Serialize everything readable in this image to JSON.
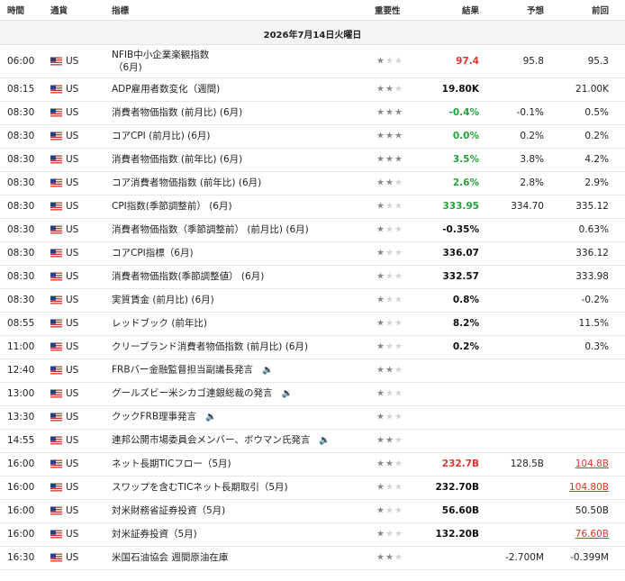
{
  "header": {
    "time": "時間",
    "currency": "通貨",
    "indicator": "指標",
    "importance": "重要性",
    "actual": "結果",
    "forecast": "予想",
    "previous": "前回"
  },
  "date_label": "2026年7月14日火曜日",
  "rows": [
    {
      "time": "06:00",
      "currency": "US",
      "name": "NFIB中小企業楽観指数",
      "name2": "（6月)",
      "stars": 1,
      "actual": "97.4",
      "actual_color": "red",
      "forecast": "95.8",
      "previous": "95.3",
      "prev_link": false,
      "speech": false
    },
    {
      "time": "08:15",
      "currency": "US",
      "name": "ADP雇用者数変化（週間)",
      "stars": 2,
      "actual": "19.80K",
      "actual_color": "black",
      "forecast": "",
      "previous": "21.00K",
      "prev_link": false,
      "speech": false
    },
    {
      "time": "08:30",
      "currency": "US",
      "name": "消費者物価指数 (前月比) (6月)",
      "stars": 3,
      "actual": "-0.4%",
      "actual_color": "green",
      "forecast": "-0.1%",
      "previous": "0.5%",
      "prev_link": false,
      "speech": false
    },
    {
      "time": "08:30",
      "currency": "US",
      "name": "コアCPI (前月比) (6月)",
      "stars": 3,
      "actual": "0.0%",
      "actual_color": "green",
      "forecast": "0.2%",
      "previous": "0.2%",
      "prev_link": false,
      "speech": false
    },
    {
      "time": "08:30",
      "currency": "US",
      "name": "消費者物価指数 (前年比) (6月)",
      "stars": 3,
      "actual": "3.5%",
      "actual_color": "green",
      "forecast": "3.8%",
      "previous": "4.2%",
      "prev_link": false,
      "speech": false
    },
    {
      "time": "08:30",
      "currency": "US",
      "name": "コア消費者物価指数 (前年比) (6月)",
      "stars": 2,
      "actual": "2.6%",
      "actual_color": "green",
      "forecast": "2.8%",
      "previous": "2.9%",
      "prev_link": false,
      "speech": false
    },
    {
      "time": "08:30",
      "currency": "US",
      "name": "CPI指数(季節調整前）  (6月)",
      "stars": 1,
      "actual": "333.95",
      "actual_color": "green",
      "forecast": "334.70",
      "previous": "335.12",
      "prev_link": false,
      "speech": false
    },
    {
      "time": "08:30",
      "currency": "US",
      "name": "消費者物価指数（季節調整前） (前月比) (6月)",
      "stars": 1,
      "actual": "-0.35%",
      "actual_color": "black",
      "forecast": "",
      "previous": "0.63%",
      "prev_link": false,
      "speech": false
    },
    {
      "time": "08:30",
      "currency": "US",
      "name": "コアCPI指標（6月)",
      "stars": 1,
      "actual": "336.07",
      "actual_color": "black",
      "forecast": "",
      "previous": "336.12",
      "prev_link": false,
      "speech": false
    },
    {
      "time": "08:30",
      "currency": "US",
      "name": "消費者物価指数(季節調整値） (6月)",
      "stars": 1,
      "actual": "332.57",
      "actual_color": "black",
      "forecast": "",
      "previous": "333.98",
      "prev_link": false,
      "speech": false
    },
    {
      "time": "08:30",
      "currency": "US",
      "name": "実質賃金 (前月比) (6月)",
      "stars": 1,
      "actual": "0.8%",
      "actual_color": "black",
      "forecast": "",
      "previous": "-0.2%",
      "prev_link": false,
      "speech": false
    },
    {
      "time": "08:55",
      "currency": "US",
      "name": "レッドブック (前年比)",
      "stars": 1,
      "actual": "8.2%",
      "actual_color": "black",
      "forecast": "",
      "previous": "11.5%",
      "prev_link": false,
      "speech": false
    },
    {
      "time": "11:00",
      "currency": "US",
      "name": "クリーブランド消費者物価指数 (前月比) (6月)",
      "stars": 1,
      "actual": "0.2%",
      "actual_color": "black",
      "forecast": "",
      "previous": "0.3%",
      "prev_link": false,
      "speech": false
    },
    {
      "time": "12:40",
      "currency": "US",
      "name": "FRBバー金融監督担当副議長発言",
      "stars": 2,
      "actual": "",
      "actual_color": "black",
      "forecast": "",
      "previous": "",
      "prev_link": false,
      "speech": true
    },
    {
      "time": "13:00",
      "currency": "US",
      "name": "グールズビー米シカゴ連銀総裁の発言",
      "stars": 1,
      "actual": "",
      "actual_color": "black",
      "forecast": "",
      "previous": "",
      "prev_link": false,
      "speech": true
    },
    {
      "time": "13:30",
      "currency": "US",
      "name": "クックFRB理事発言",
      "stars": 1,
      "actual": "",
      "actual_color": "black",
      "forecast": "",
      "previous": "",
      "prev_link": false,
      "speech": true
    },
    {
      "time": "14:55",
      "currency": "US",
      "name": "連邦公開市場委員会メンバー、ボウマン氏発言",
      "stars": 2,
      "actual": "",
      "actual_color": "black",
      "forecast": "",
      "previous": "",
      "prev_link": false,
      "speech": true
    },
    {
      "time": "16:00",
      "currency": "US",
      "name": "ネット長期TICフロー（5月)",
      "stars": 2,
      "actual": "232.7B",
      "actual_color": "red",
      "forecast": "128.5B",
      "previous": "104.8B",
      "prev_link": true,
      "speech": false
    },
    {
      "time": "16:00",
      "currency": "US",
      "name": "スワップを含むTICネット長期取引（5月)",
      "stars": 1,
      "actual": "232.70B",
      "actual_color": "black",
      "forecast": "",
      "previous": "104.80B",
      "prev_link": true,
      "speech": false
    },
    {
      "time": "16:00",
      "currency": "US",
      "name": "対米財務省証券投資（5月)",
      "stars": 1,
      "actual": "56.60B",
      "actual_color": "black",
      "forecast": "",
      "previous": "50.50B",
      "prev_link": false,
      "speech": false
    },
    {
      "time": "16:00",
      "currency": "US",
      "name": "対米証券投資（5月)",
      "stars": 1,
      "actual": "132.20B",
      "actual_color": "black",
      "forecast": "",
      "previous": "76.60B",
      "prev_link": true,
      "speech": false
    },
    {
      "time": "16:30",
      "currency": "US",
      "name": "米国石油協会 週間原油在庫",
      "stars": 2,
      "actual": "",
      "actual_color": "black",
      "forecast": "-2.700M",
      "previous": "-0.399M",
      "prev_link": false,
      "speech": false
    }
  ]
}
